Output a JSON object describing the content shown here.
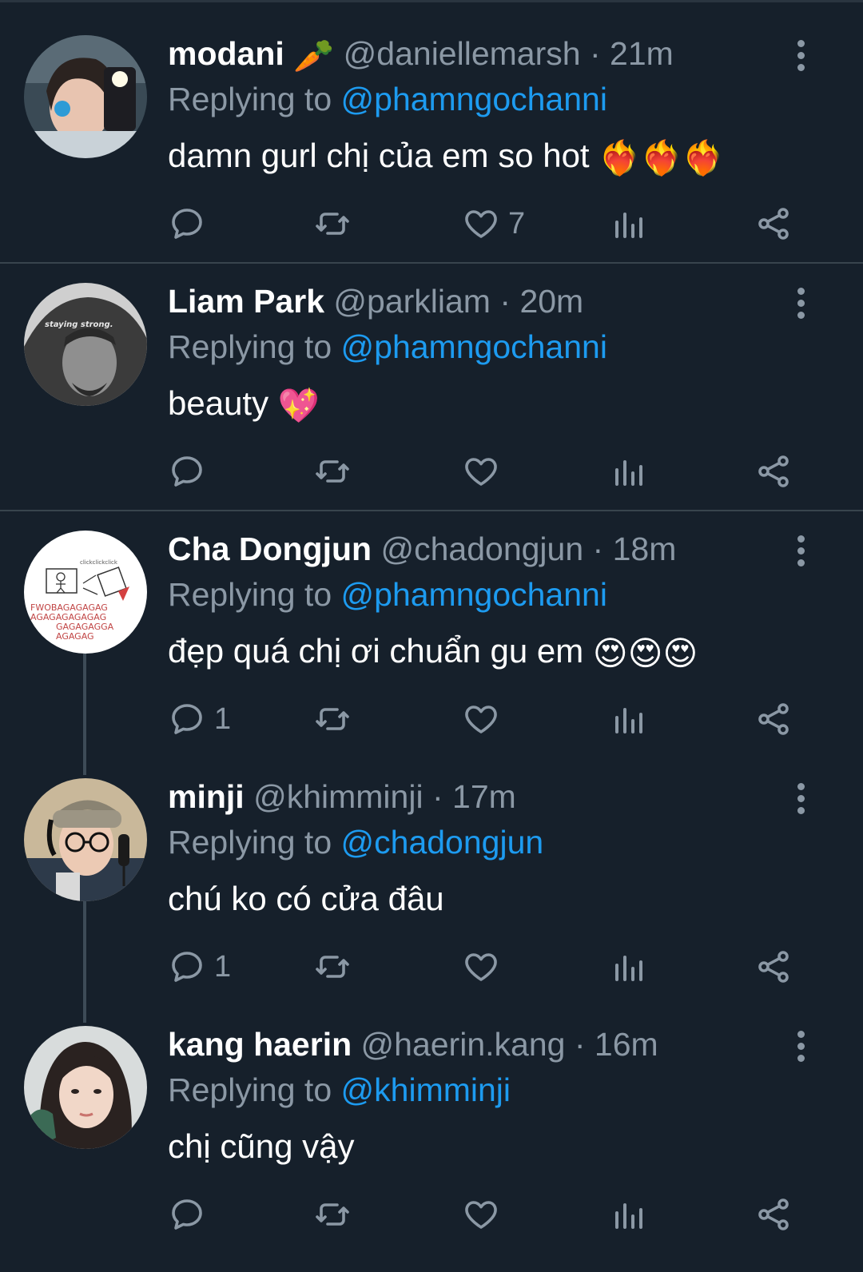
{
  "colors": {
    "background": "#16202b",
    "accent": "#1d9bf0",
    "muted": "#8b98a5",
    "divider": "#38444d"
  },
  "tweets": [
    {
      "name": "modani",
      "name_emoji": "🥕",
      "handle": "@daniellemarsh",
      "dot": "·",
      "time": "21m",
      "replying_to_label": "Replying to",
      "replying_to": "@phamngochanni",
      "text": "damn gurl chị của em so hot",
      "text_emoji": "❤️‍🔥❤️‍🔥❤️‍🔥",
      "reply_count": "",
      "retweet_count": "",
      "like_count": "7"
    },
    {
      "name": "Liam Park",
      "name_emoji": "",
      "handle": "@parkliam",
      "dot": "·",
      "time": "20m",
      "replying_to_label": "Replying to",
      "replying_to": "@phamngochanni",
      "text": "beauty",
      "text_emoji": "💖",
      "reply_count": "",
      "retweet_count": "",
      "like_count": ""
    },
    {
      "name": "Cha Dongjun",
      "name_emoji": "",
      "handle": "@chadongjun",
      "dot": "·",
      "time": "18m",
      "replying_to_label": "Replying to",
      "replying_to": "@phamngochanni",
      "text": "đẹp quá chị ơi chuẩn gu em",
      "text_emoji": "😍😍😍",
      "reply_count": "1",
      "retweet_count": "",
      "like_count": "",
      "avatar_text": [
        "clickclickclick",
        "FWOBAGAGAGAG",
        "AGAGAGAGAGAG",
        "GAGAGAGGA",
        "AGAGAG"
      ]
    },
    {
      "name": "minji",
      "name_emoji": "",
      "handle": "@khimminji",
      "dot": "·",
      "time": "17m",
      "replying_to_label": "Replying to",
      "replying_to": "@chadongjun",
      "text": "chú ko có cửa đâu",
      "text_emoji": "",
      "reply_count": "1",
      "retweet_count": "",
      "like_count": ""
    },
    {
      "name": "kang haerin",
      "name_emoji": "",
      "handle": "@haerin.kang",
      "dot": "·",
      "time": "16m",
      "replying_to_label": "Replying to",
      "replying_to": "@khimminji",
      "text": "chị cũng vậy",
      "text_emoji": "",
      "reply_count": "",
      "retweet_count": "",
      "like_count": ""
    }
  ],
  "avatar_labels": {
    "liam": "staying strong."
  }
}
